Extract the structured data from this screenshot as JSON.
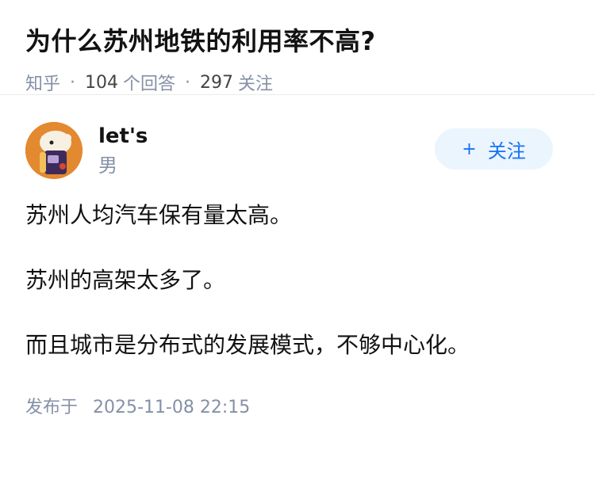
{
  "question": {
    "title": "为什么苏州地铁的利用率不高?",
    "source": "知乎",
    "answers_count": "104",
    "answers_label": "个回答",
    "followers_count": "297",
    "followers_label": "关注"
  },
  "answer": {
    "author": {
      "name": "let's",
      "gender": "男",
      "avatar_icon": "avatar-image"
    },
    "follow_button": {
      "plus": "+",
      "label": "关注"
    },
    "paragraphs": [
      "苏州人均汽车保有量太高。",
      "苏州的高架太多了。",
      "而且城市是分布式的发展模式，不够中心化。"
    ],
    "published_label": "发布于",
    "published_time": "2025-11-08 22:15"
  },
  "colors": {
    "accent": "#1772f6",
    "follow_bg": "#ebf5fd",
    "meta_gray": "#8590a6",
    "avatar_bg": "#e3892f"
  }
}
